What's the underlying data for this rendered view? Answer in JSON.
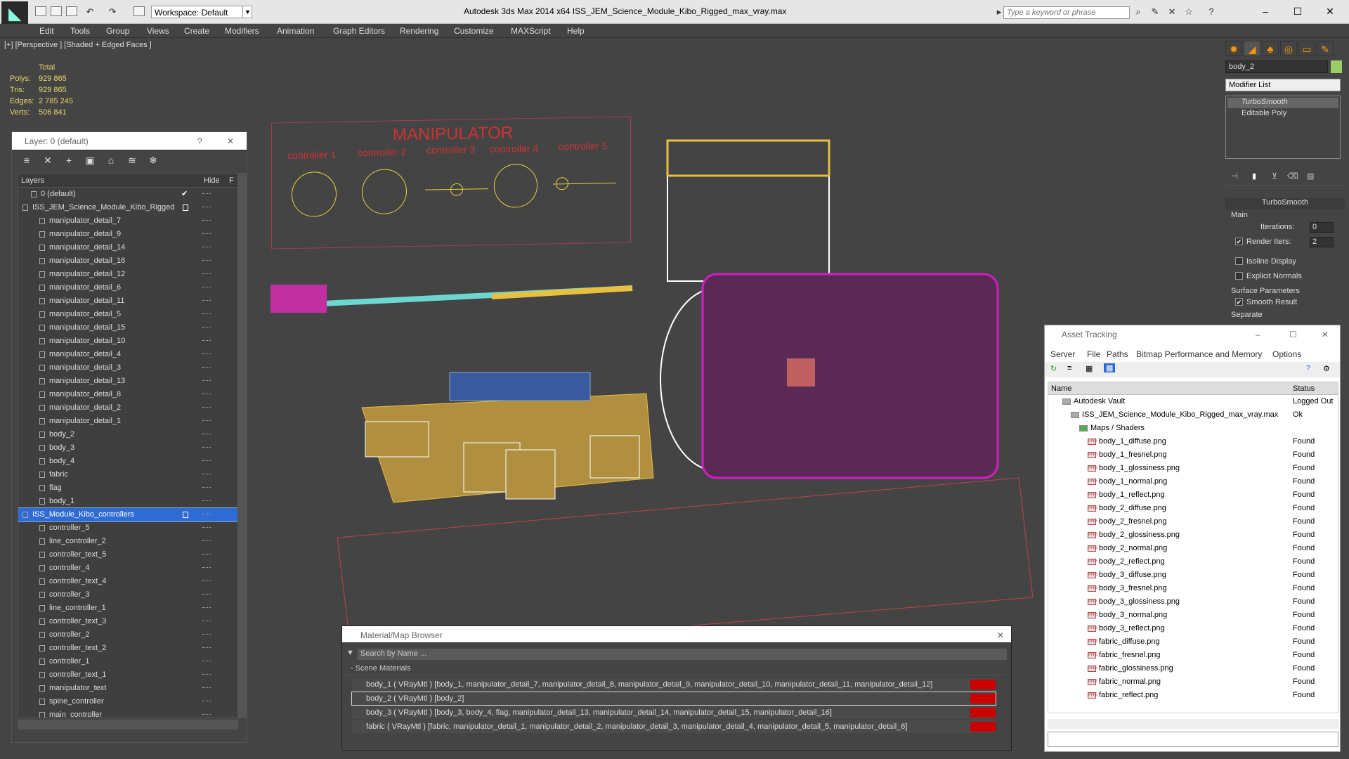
{
  "app": {
    "title": "Autodesk 3ds Max  2014 x64      ISS_JEM_Science_Module_Kibo_Rigged_max_vray.max",
    "workspace": "Workspace: Default",
    "search_placeholder": "Type a keyword or phrase"
  },
  "menu": [
    "Edit",
    "Tools",
    "Group",
    "Views",
    "Create",
    "Modifiers",
    "Animation",
    "Graph Editors",
    "Rendering",
    "Customize",
    "MAXScript",
    "Help"
  ],
  "viewport": {
    "label": "[+] [Perspective ] [Shaded + Edged Faces ]",
    "stats": {
      "header": "Total",
      "rows": [
        {
          "label": "Polys:",
          "value": "929 865"
        },
        {
          "label": "Tris:",
          "value": "929 865"
        },
        {
          "label": "Edges:",
          "value": "2 785 245"
        },
        {
          "label": "Verts:",
          "value": "506 841"
        }
      ]
    },
    "board": {
      "title": "MANIPULATOR",
      "controllers": [
        "controller 1",
        "controller 2",
        "controller 3",
        "controller 4",
        "controller 5"
      ]
    }
  },
  "layer_panel": {
    "title": "Layer: 0 (default)",
    "help": "?",
    "col_layers": "Layers",
    "col_hide": "Hide",
    "col_extra": "F",
    "rows": [
      {
        "name": "0 (default)",
        "level": 1,
        "check": "✔"
      },
      {
        "name": "ISS_JEM_Science_Module_Kibo_Rigged",
        "level": 0,
        "box": true
      },
      {
        "name": "manipulator_detail_7",
        "level": 2
      },
      {
        "name": "manipulator_detail_9",
        "level": 2
      },
      {
        "name": "manipulator_detail_14",
        "level": 2
      },
      {
        "name": "manipulator_detail_16",
        "level": 2
      },
      {
        "name": "manipulator_detail_12",
        "level": 2
      },
      {
        "name": "manipulator_detail_6",
        "level": 2
      },
      {
        "name": "manipulator_detail_11",
        "level": 2
      },
      {
        "name": "manipulator_detail_5",
        "level": 2
      },
      {
        "name": "manipulator_detail_15",
        "level": 2
      },
      {
        "name": "manipulator_detail_10",
        "level": 2
      },
      {
        "name": "manipulator_detail_4",
        "level": 2
      },
      {
        "name": "manipulator_detail_3",
        "level": 2
      },
      {
        "name": "manipulator_detail_13",
        "level": 2
      },
      {
        "name": "manipulator_detail_8",
        "level": 2
      },
      {
        "name": "manipulator_detail_2",
        "level": 2
      },
      {
        "name": "manipulator_detail_1",
        "level": 2
      },
      {
        "name": "body_2",
        "level": 2
      },
      {
        "name": "body_3",
        "level": 2
      },
      {
        "name": "body_4",
        "level": 2
      },
      {
        "name": "fabric",
        "level": 2
      },
      {
        "name": "flag",
        "level": 2
      },
      {
        "name": "body_1",
        "level": 2
      },
      {
        "name": "ISS_Module_Kibo_controllers",
        "level": 0,
        "selected": true,
        "box": true
      },
      {
        "name": "controller_5",
        "level": 2
      },
      {
        "name": "line_controller_2",
        "level": 2
      },
      {
        "name": "controller_text_5",
        "level": 2
      },
      {
        "name": "controller_4",
        "level": 2
      },
      {
        "name": "controller_text_4",
        "level": 2
      },
      {
        "name": "controller_3",
        "level": 2
      },
      {
        "name": "line_controller_1",
        "level": 2
      },
      {
        "name": "controller_text_3",
        "level": 2
      },
      {
        "name": "controller_2",
        "level": 2
      },
      {
        "name": "controller_text_2",
        "level": 2
      },
      {
        "name": "controller_1",
        "level": 2
      },
      {
        "name": "controller_text_1",
        "level": 2
      },
      {
        "name": "manipulator_text",
        "level": 2
      },
      {
        "name": "spine_controller",
        "level": 2
      },
      {
        "name": "main_controller",
        "level": 2
      }
    ]
  },
  "material_browser": {
    "title": "Material/Map Browser",
    "search": "Search by Name ...",
    "section": "- Scene Materials",
    "rows": [
      "body_1  ( VRayMtl ) [body_1, manipulator_detail_7, manipulator_detail_8, manipulator_detail_9, manipulator_detail_10, manipulator_detail_11, manipulator_detail_12]",
      "body_2  ( VRayMtl )  [body_2]",
      "body_3  ( VRayMtl ) [body_3, body_4, flag, manipulator_detail_13, manipulator_detail_14, manipulator_detail_15, manipulator_detail_16]",
      "fabric  ( VRayMtl ) [fabric, manipulator_detail_1, manipulator_detail_2, manipulator_detail_3, manipulator_detail_4, manipulator_detail_5, manipulator_detail_6]"
    ]
  },
  "asset_tracking": {
    "title": "Asset Tracking",
    "menu": [
      "Server",
      "File",
      "Paths",
      "Bitmap Performance and Memory",
      "Options"
    ],
    "col_name": "Name",
    "col_status": "Status",
    "rows": [
      {
        "name": "Autodesk Vault",
        "status": "Logged Out",
        "indent": 1,
        "kind": "vault"
      },
      {
        "name": "ISS_JEM_Science_Module_Kibo_Rigged_max_vray.max",
        "status": "Ok",
        "indent": 2,
        "kind": "max"
      },
      {
        "name": "Maps / Shaders",
        "status": "",
        "indent": 3,
        "kind": "maps"
      },
      {
        "name": "body_1_diffuse.png",
        "status": "Found",
        "indent": 4,
        "kind": "png"
      },
      {
        "name": "body_1_fresnel.png",
        "status": "Found",
        "indent": 4,
        "kind": "png"
      },
      {
        "name": "body_1_glossiness.png",
        "status": "Found",
        "indent": 4,
        "kind": "png"
      },
      {
        "name": "body_1_normal.png",
        "status": "Found",
        "indent": 4,
        "kind": "png"
      },
      {
        "name": "body_1_reflect.png",
        "status": "Found",
        "indent": 4,
        "kind": "png"
      },
      {
        "name": "body_2_diffuse.png",
        "status": "Found",
        "indent": 4,
        "kind": "png"
      },
      {
        "name": "body_2_fresnel.png",
        "status": "Found",
        "indent": 4,
        "kind": "png"
      },
      {
        "name": "body_2_glossiness.png",
        "status": "Found",
        "indent": 4,
        "kind": "png"
      },
      {
        "name": "body_2_normal.png",
        "status": "Found",
        "indent": 4,
        "kind": "png"
      },
      {
        "name": "body_2_reflect.png",
        "status": "Found",
        "indent": 4,
        "kind": "png"
      },
      {
        "name": "body_3_diffuse.png",
        "status": "Found",
        "indent": 4,
        "kind": "png"
      },
      {
        "name": "body_3_fresnel.png",
        "status": "Found",
        "indent": 4,
        "kind": "png"
      },
      {
        "name": "body_3_glossiness.png",
        "status": "Found",
        "indent": 4,
        "kind": "png"
      },
      {
        "name": "body_3_normal.png",
        "status": "Found",
        "indent": 4,
        "kind": "png"
      },
      {
        "name": "body_3_reflect.png",
        "status": "Found",
        "indent": 4,
        "kind": "png"
      },
      {
        "name": "fabric_diffuse.png",
        "status": "Found",
        "indent": 4,
        "kind": "png"
      },
      {
        "name": "fabric_fresnel.png",
        "status": "Found",
        "indent": 4,
        "kind": "png"
      },
      {
        "name": "fabric_glossiness.png",
        "status": "Found",
        "indent": 4,
        "kind": "png"
      },
      {
        "name": "fabric_normal.png",
        "status": "Found",
        "indent": 4,
        "kind": "png"
      },
      {
        "name": "fabric_reflect.png",
        "status": "Found",
        "indent": 4,
        "kind": "png"
      }
    ]
  },
  "command_panel": {
    "object_name": "body_2",
    "modifier_list": "Modifier List",
    "stack": [
      "TurboSmooth",
      "Editable Poly"
    ],
    "rollout_title": "TurboSmooth",
    "main_label": "Main",
    "iterations_label": "Iterations:",
    "iterations_value": "0",
    "render_iters_label": "Render Iters:",
    "render_iters_value": "2",
    "isoline": "Isoline Display",
    "explicit": "Explicit Normals",
    "surface_params": "Surface Parameters",
    "smooth_result": "Smooth Result",
    "separate": "Separate"
  },
  "colors": {
    "selection": "#2f6bd4",
    "wire_yellow": "#e8c040",
    "wire_magenta": "#d020c0",
    "wire_white": "#ffffff",
    "board_red": "#cc3333"
  }
}
